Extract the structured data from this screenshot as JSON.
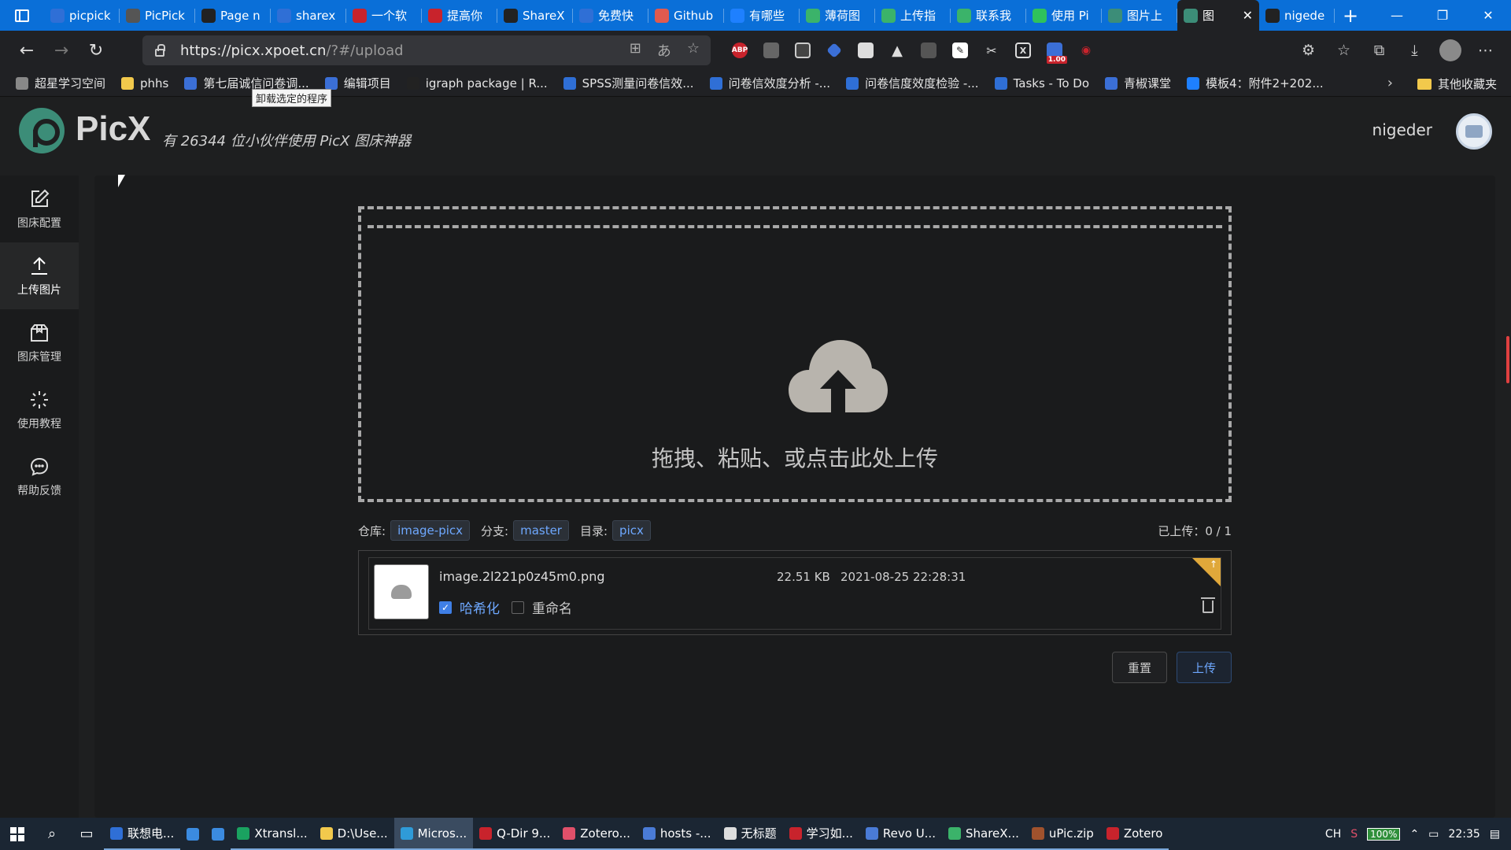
{
  "browser": {
    "tabs": [
      {
        "title": "picpick",
        "color": "#2f6fd6"
      },
      {
        "title": "PicPick",
        "color": "#555555"
      },
      {
        "title": "Page n",
        "color": "#222222"
      },
      {
        "title": "sharex",
        "color": "#2f6fd6"
      },
      {
        "title": "一个软",
        "color": "#c8232c"
      },
      {
        "title": "提高你",
        "color": "#c8232c"
      },
      {
        "title": "ShareX",
        "color": "#222222"
      },
      {
        "title": "免费快",
        "color": "#2f6fd6"
      },
      {
        "title": "Github",
        "color": "#e05a4f"
      },
      {
        "title": "有哪些",
        "color": "#1e80ff"
      },
      {
        "title": "薄荷图",
        "color": "#3bb36a"
      },
      {
        "title": "上传指",
        "color": "#3bb36a"
      },
      {
        "title": "联系我",
        "color": "#3bb36a"
      },
      {
        "title": "使用 Pi",
        "color": "#2fc25b"
      },
      {
        "title": "图片上",
        "color": "#3c8d78"
      },
      {
        "title": "图",
        "color": "#3c8d78",
        "active": true
      },
      {
        "title": "nigede",
        "color": "#222222"
      }
    ],
    "url_host": "https://picx.xpoet.cn",
    "url_path": "/?#/upload",
    "ext_badge": "1.00",
    "bookmarks": [
      {
        "label": "超星学习空间",
        "color": "#888888"
      },
      {
        "label": "phhs",
        "color": "#f2c94c"
      },
      {
        "label": "第七届诚信问卷调...",
        "color": "#3b6fd6"
      },
      {
        "label": "编辑项目",
        "color": "#3b6fd6"
      },
      {
        "label": "igraph package | R...",
        "color": "#222222"
      },
      {
        "label": "SPSS测量问卷信效...",
        "color": "#2f6fd6"
      },
      {
        "label": "问卷信效度分析 -...",
        "color": "#2f6fd6"
      },
      {
        "label": "问卷信度效度检验 -...",
        "color": "#2f6fd6"
      },
      {
        "label": "Tasks - To Do",
        "color": "#2f6fd6"
      },
      {
        "label": "青椒课堂",
        "color": "#3b6fd6"
      },
      {
        "label": "模板4：附件2+202...",
        "color": "#1e80ff"
      }
    ],
    "other_bookmarks": "其他收藏夹",
    "tooltip": "卸载选定的程序"
  },
  "app": {
    "brand": "PicX",
    "slogan": "有 26344 位小伙伴使用 PicX 图床神器",
    "user": "nigeder",
    "sidebar": [
      {
        "label": "图床配置",
        "icon": "edit-icon"
      },
      {
        "label": "上传图片",
        "icon": "upload-icon",
        "active": true
      },
      {
        "label": "图床管理",
        "icon": "package-icon"
      },
      {
        "label": "使用教程",
        "icon": "loading-icon"
      },
      {
        "label": "帮助反馈",
        "icon": "chat-icon"
      }
    ],
    "dropzone_text": "拖拽、粘贴、或点击此处上传",
    "repo_label": "仓库:",
    "repo_value": "image-picx",
    "branch_label": "分支:",
    "branch_value": "master",
    "dir_label": "目录:",
    "dir_value": "picx",
    "uploaded_status": "已上传：0 / 1",
    "file": {
      "name": "image.2l221p0z45m0.png",
      "size": "22.51 KB",
      "date": "2021-08-25 22:28:31",
      "hash_label": "哈希化",
      "hash_checked": true,
      "rename_label": "重命名",
      "rename_checked": false
    },
    "reset_label": "重置",
    "upload_label": "上传"
  },
  "taskbar": {
    "apps": [
      {
        "label": "联想电...",
        "color": "#2f6fd6"
      },
      {
        "label": "",
        "color": "#3b8be0",
        "icon_only": true
      },
      {
        "label": "",
        "color": "#3b8be0",
        "icon_only": true
      },
      {
        "label": "Xtransl...",
        "color": "#1aa260"
      },
      {
        "label": "D:\\Use...",
        "color": "#f2c94c"
      },
      {
        "label": "Micros...",
        "color": "#2f9bd8",
        "active": true
      },
      {
        "label": "Q-Dir 9...",
        "color": "#c8232c"
      },
      {
        "label": "Zotero...",
        "color": "#e0506a"
      },
      {
        "label": "hosts -...",
        "color": "#4a7bd6"
      },
      {
        "label": "无标题",
        "color": "#dddddd"
      },
      {
        "label": "学习如...",
        "color": "#c8232c"
      },
      {
        "label": "Revo U...",
        "color": "#4a7bd6"
      },
      {
        "label": "ShareX...",
        "color": "#3bb36a"
      },
      {
        "label": "uPic.zip",
        "color": "#a0522d"
      },
      {
        "label": "Zotero",
        "color": "#c8232c"
      }
    ],
    "lang": "CH",
    "battery": "100%",
    "time": "22:35"
  }
}
